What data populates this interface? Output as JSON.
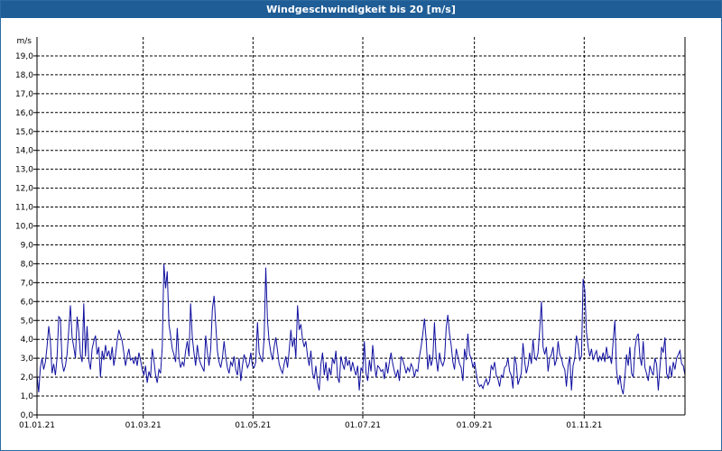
{
  "window": {
    "title": "Windgeschwindigkeit bis 20 [m/s]"
  },
  "chart_data": {
    "type": "line",
    "title": "Windgeschwindigkeit bis 20 [m/s]",
    "ylabel": "m/s",
    "xlabel": "",
    "ylim": [
      0,
      20
    ],
    "grid": true,
    "line_color": "#1010a0",
    "y_ticks": [
      "0,0",
      "1,0",
      "2,0",
      "3,0",
      "4,0",
      "5,0",
      "6,0",
      "7,0",
      "8,0",
      "9,0",
      "10,0",
      "11,0",
      "12,0",
      "13,0",
      "14,0",
      "15,0",
      "16,0",
      "17,0",
      "18,0",
      "19,0"
    ],
    "x_ticks": [
      "01.01.21",
      "01.03.21",
      "01.05.21",
      "01.07.21",
      "01.09.21",
      "01.11.21"
    ],
    "x_tick_days": [
      0,
      59,
      120,
      181,
      243,
      304
    ],
    "xlim_days": [
      0,
      360
    ],
    "series": [
      {
        "values": [
          2.1,
          1.2,
          2.5,
          3.0,
          2.4,
          2.8,
          3.6,
          4.7,
          3.9,
          2.2,
          2.7,
          2.1,
          3.0,
          5.2,
          5.1,
          2.8,
          2.3,
          2.6,
          3.2,
          4.5,
          5.8,
          4.1,
          3.6,
          3.0,
          5.2,
          4.4,
          3.2,
          2.8,
          5.9,
          3.1,
          4.7,
          2.9,
          2.4,
          3.5,
          3.9,
          4.2,
          3.2,
          3.6,
          2.0,
          3.4,
          2.9,
          3.7,
          3.1,
          3.4,
          2.9,
          3.6,
          2.6,
          3.2,
          3.9,
          4.5,
          4.2,
          3.9,
          3.3,
          2.6,
          3.1,
          3.5,
          2.9,
          3.0,
          2.7,
          3.1,
          2.6,
          3.3,
          2.9,
          2.4,
          2.1,
          2.6,
          1.7,
          2.3,
          2.0,
          3.5,
          2.9,
          2.1,
          1.7,
          2.4,
          2.2,
          3.6,
          8.0,
          6.7,
          7.6,
          4.8,
          4.2,
          3.5,
          3.2,
          2.8,
          4.6,
          3.0,
          2.5,
          2.8,
          2.6,
          3.4,
          3.9,
          3.1,
          5.9,
          4.1,
          3.3,
          2.6,
          3.7,
          3.0,
          2.7,
          2.5,
          2.3,
          4.2,
          3.3,
          2.6,
          3.5,
          5.6,
          6.3,
          4.8,
          3.4,
          2.8,
          2.5,
          3.0,
          3.9,
          3.1,
          2.5,
          2.2,
          2.8,
          2.6,
          3.1,
          2.4,
          2.1,
          3.0,
          1.8,
          2.6,
          3.2,
          2.9,
          2.5,
          2.7,
          3.3,
          2.6,
          2.5,
          2.8,
          4.9,
          3.3,
          3.0,
          2.8,
          4.1,
          7.8,
          5.0,
          3.9,
          3.3,
          2.9,
          3.6,
          4.1,
          3.4,
          2.7,
          2.4,
          2.2,
          2.7,
          3.1,
          2.5,
          3.4,
          4.5,
          3.6,
          4.1,
          3.0,
          5.8,
          4.5,
          4.8,
          4.0,
          3.6,
          3.9,
          3.1,
          2.6,
          3.4,
          2.2,
          1.9,
          2.6,
          1.7,
          1.3,
          2.7,
          3.3,
          2.1,
          2.8,
          1.8,
          2.5,
          2.1,
          3.0,
          2.7,
          3.4,
          2.0,
          1.7,
          3.1,
          2.7,
          2.4,
          3.1,
          2.6,
          2.9,
          2.3,
          2.8,
          2.4,
          2.1,
          2.6,
          1.3,
          2.5,
          2.3,
          3.9,
          2.2,
          1.8,
          2.9,
          2.3,
          3.7,
          2.7,
          2.0,
          2.6,
          2.5,
          2.3,
          2.4,
          1.9,
          2.8,
          2.2,
          2.8,
          3.3,
          2.7,
          2.3,
          2.0,
          2.4,
          1.8,
          3.1,
          2.9,
          2.6,
          2.2,
          2.5,
          2.3,
          2.7,
          2.5,
          2.0,
          2.4,
          2.3,
          3.1,
          3.6,
          4.3,
          5.1,
          4.0,
          2.4,
          3.2,
          2.6,
          3.0,
          4.9,
          3.0,
          2.3,
          3.3,
          2.8,
          2.6,
          2.9,
          4.6,
          5.3,
          4.3,
          3.7,
          2.8,
          2.4,
          3.5,
          3.1,
          2.7,
          2.5,
          1.8,
          3.5,
          2.9,
          4.3,
          3.2,
          3.0,
          2.5,
          2.8,
          2.2,
          1.7,
          1.5,
          1.6,
          1.4,
          1.7,
          1.9,
          1.6,
          1.8,
          2.6,
          2.4,
          2.8,
          2.1,
          1.9,
          1.5,
          2.1,
          2.0,
          2.5,
          2.6,
          3.0,
          2.3,
          2.1,
          1.4,
          3.1,
          2.7,
          1.6,
          1.9,
          2.2,
          3.8,
          2.8,
          2.2,
          2.6,
          3.3,
          2.7,
          4.0,
          3.0,
          2.9,
          3.3,
          4.5,
          6.0,
          3.6,
          3.2,
          3.6,
          2.3,
          3.0,
          3.2,
          3.6,
          2.6,
          2.9,
          3.9,
          3.2,
          3.0,
          2.6,
          2.4,
          1.5,
          2.6,
          3.1,
          1.3,
          2.6,
          3.0,
          4.2,
          3.7,
          2.9,
          3.1,
          7.2,
          6.6,
          4.4,
          3.6,
          3.1,
          3.5,
          2.9,
          3.2,
          3.4,
          2.8,
          3.1,
          2.9,
          3.3,
          2.8,
          3.6,
          3.0,
          3.1,
          2.7,
          3.9,
          5.0,
          2.4,
          1.6,
          2.1,
          1.4,
          1.1,
          2.0,
          3.2,
          2.6,
          3.6,
          2.2,
          2.0,
          3.5,
          4.1,
          4.3,
          3.1,
          2.6,
          3.9,
          2.5,
          2.2,
          1.8,
          2.6,
          2.3,
          2.1,
          3.0,
          2.7,
          1.3,
          2.5,
          3.6,
          3.3,
          4.1,
          2.2,
          1.9,
          2.6,
          2.0,
          2.8,
          2.4,
          3.0,
          3.2,
          3.4,
          2.7,
          2.6,
          2.1
        ]
      }
    ]
  }
}
